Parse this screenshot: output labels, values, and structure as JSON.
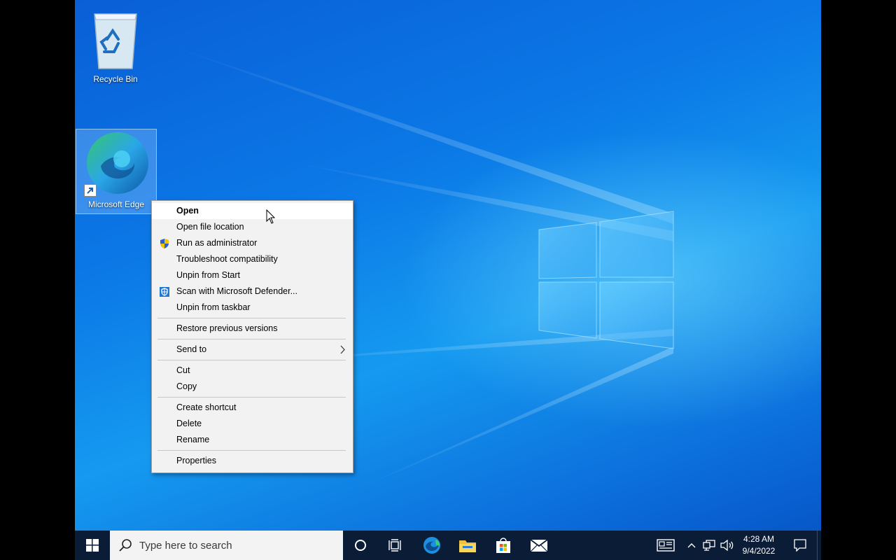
{
  "desktop": {
    "icons": [
      {
        "label": "Recycle Bin",
        "icon": "recycle-bin-icon"
      },
      {
        "label": "Microsoft Edge",
        "icon": "edge-icon",
        "selected": true
      }
    ]
  },
  "context_menu": {
    "items": [
      {
        "label": "Open",
        "bold": true,
        "hover": true
      },
      {
        "label": "Open file location"
      },
      {
        "label": "Run as administrator",
        "icon": "uac-shield-icon"
      },
      {
        "label": "Troubleshoot compatibility"
      },
      {
        "label": "Unpin from Start"
      },
      {
        "label": "Scan with Microsoft Defender...",
        "icon": "defender-icon"
      },
      {
        "label": "Unpin from taskbar"
      },
      {
        "label": "Restore previous versions"
      },
      {
        "label": "Send to",
        "submenu": true
      },
      {
        "label": "Cut"
      },
      {
        "label": "Copy"
      },
      {
        "label": "Create shortcut"
      },
      {
        "label": "Delete"
      },
      {
        "label": "Rename"
      },
      {
        "label": "Properties"
      }
    ]
  },
  "taskbar": {
    "search_placeholder": "Type here to search",
    "pinned": [
      "edge-icon",
      "file-explorer-icon",
      "store-icon",
      "mail-icon"
    ],
    "clock": {
      "time": "4:28 AM",
      "date": "9/4/2022"
    }
  },
  "colors": {
    "taskbar": "#0a1c36",
    "menu_bg": "#f2f2f2",
    "desktop_blue": "#0b78e6"
  }
}
